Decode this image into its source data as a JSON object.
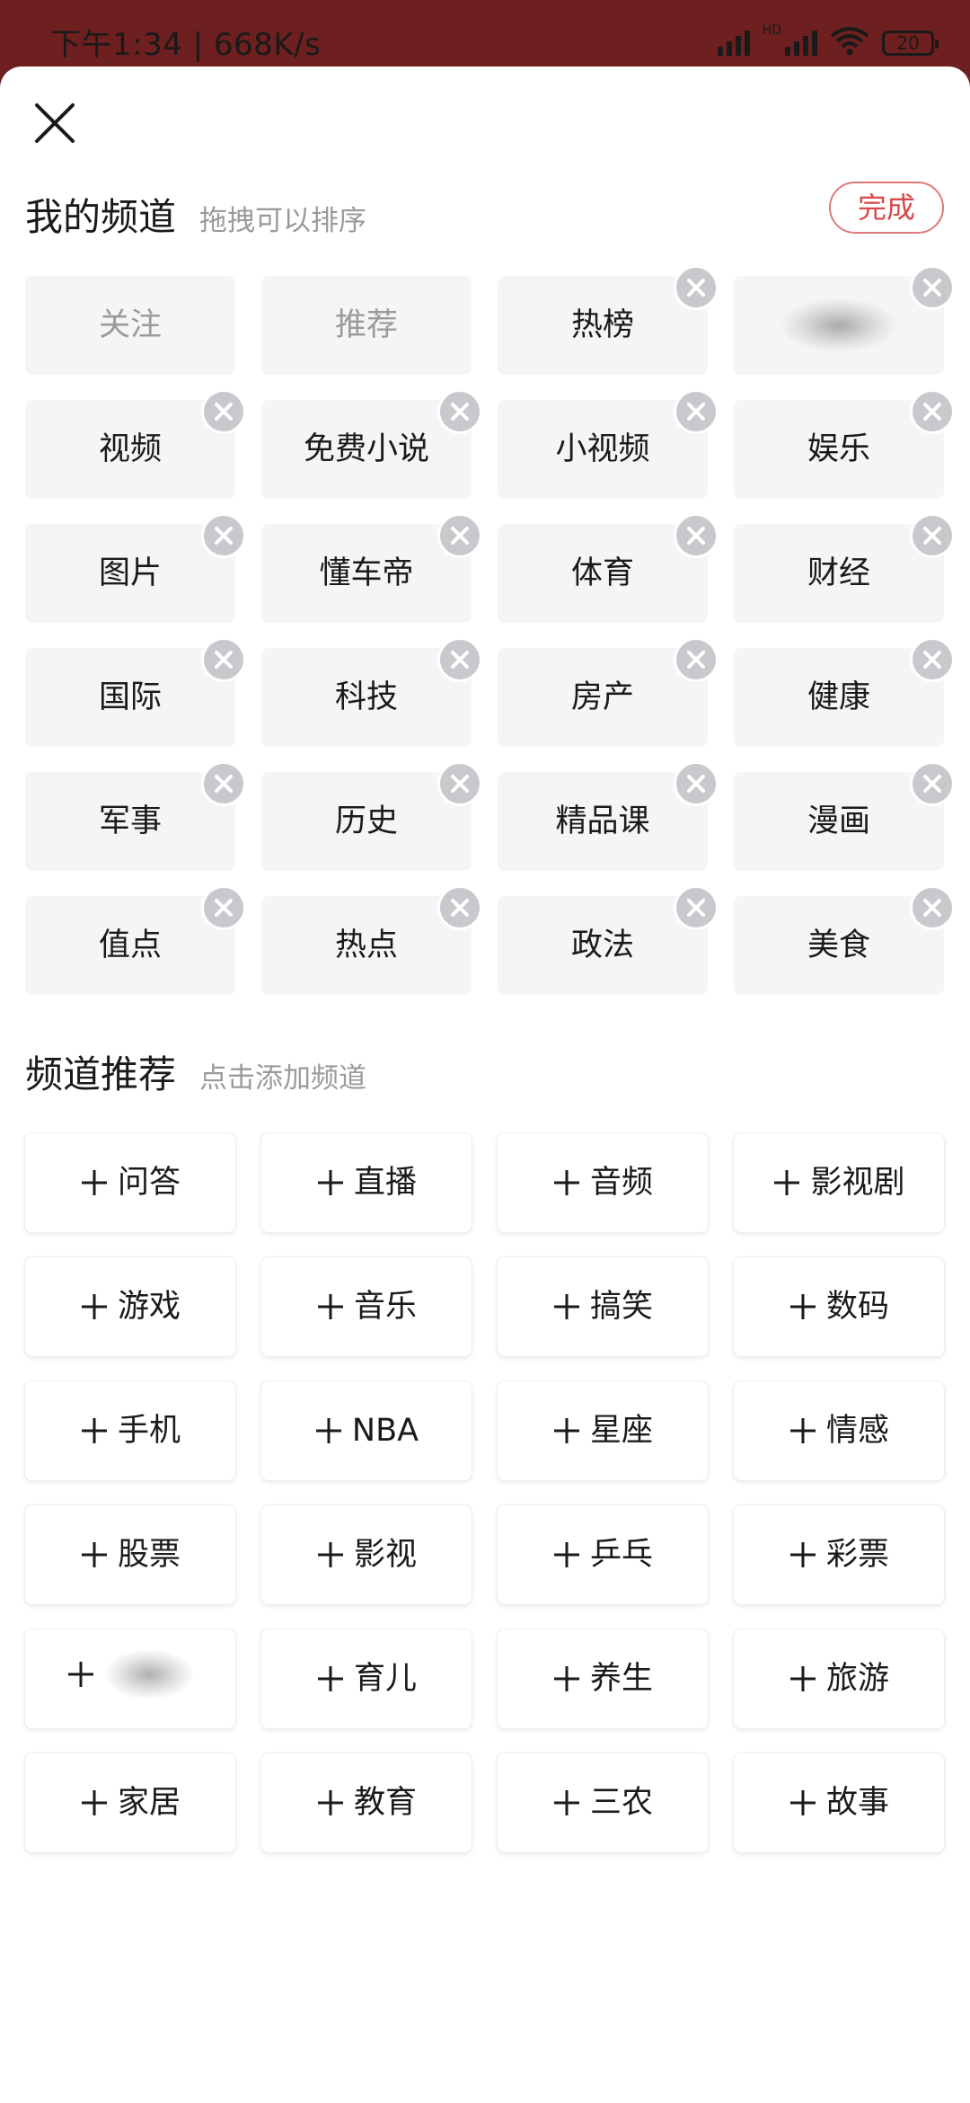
{
  "status_bar": {
    "time_speed": "下午1:34 | 668K/s",
    "network_label": "HD",
    "battery": "20"
  },
  "header": {
    "close_icon": "close-icon",
    "done_label": "完成"
  },
  "my_channels": {
    "title": "我的频道",
    "hint": "拖拽可以排序",
    "items": [
      {
        "label": "关注",
        "fixed": true
      },
      {
        "label": "推荐",
        "fixed": true
      },
      {
        "label": "热榜"
      },
      {
        "label": "",
        "obscured": true
      },
      {
        "label": "视频"
      },
      {
        "label": "免费小说"
      },
      {
        "label": "小视频"
      },
      {
        "label": "娱乐"
      },
      {
        "label": "图片"
      },
      {
        "label": "懂车帝"
      },
      {
        "label": "体育"
      },
      {
        "label": "财经"
      },
      {
        "label": "国际"
      },
      {
        "label": "科技"
      },
      {
        "label": "房产"
      },
      {
        "label": "健康"
      },
      {
        "label": "军事"
      },
      {
        "label": "历史"
      },
      {
        "label": "精品课"
      },
      {
        "label": "漫画"
      },
      {
        "label": "值点"
      },
      {
        "label": "热点"
      },
      {
        "label": "政法"
      },
      {
        "label": "美食"
      }
    ]
  },
  "recommended": {
    "title": "频道推荐",
    "hint": "点击添加频道",
    "items": [
      {
        "label": "问答"
      },
      {
        "label": "直播"
      },
      {
        "label": "音频"
      },
      {
        "label": "影视剧"
      },
      {
        "label": "游戏"
      },
      {
        "label": "音乐"
      },
      {
        "label": "搞笑"
      },
      {
        "label": "数码"
      },
      {
        "label": "手机"
      },
      {
        "label": "NBA"
      },
      {
        "label": "星座"
      },
      {
        "label": "情感"
      },
      {
        "label": "股票"
      },
      {
        "label": "影视"
      },
      {
        "label": "乒乓"
      },
      {
        "label": "彩票"
      },
      {
        "label": "",
        "obscured": true
      },
      {
        "label": "育儿"
      },
      {
        "label": "养生"
      },
      {
        "label": "旅游"
      },
      {
        "label": "家居"
      },
      {
        "label": "教育"
      },
      {
        "label": "三农"
      },
      {
        "label": "故事"
      }
    ]
  }
}
